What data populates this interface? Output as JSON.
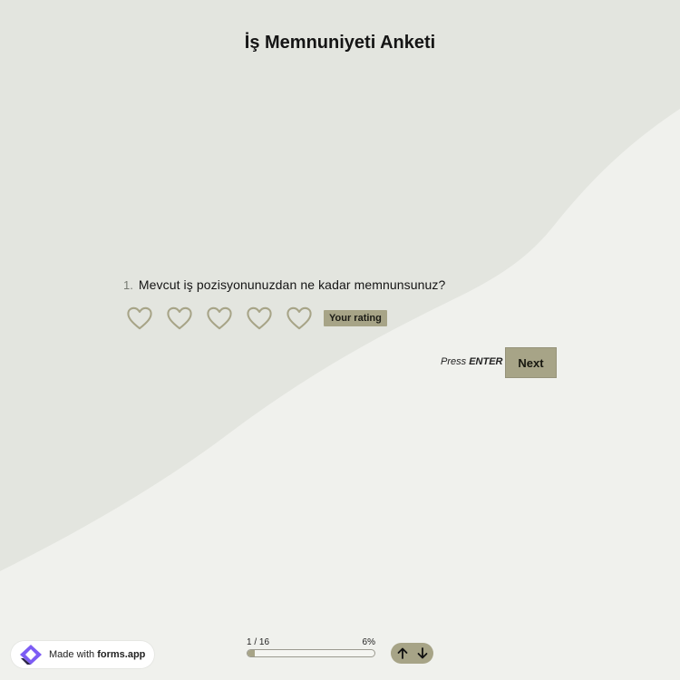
{
  "form": {
    "title": "İş Memnuniyeti Anketi"
  },
  "question": {
    "number": "1.",
    "text": "Mevcut iş pozisyonunuzdan ne kadar memnunsunuz?",
    "rating_max": 5,
    "rating_value": 0,
    "rating_tag": "Your rating",
    "icon": "heart-outline-icon"
  },
  "action": {
    "hint_prefix": "Press",
    "hint_key": "ENTER",
    "next_label": "Next"
  },
  "progress": {
    "current": "1 / 16",
    "percent_label": "6%",
    "percent_value": 6
  },
  "nav": {
    "up_icon": "arrow-up-icon",
    "down_icon": "arrow-down-icon"
  },
  "badge": {
    "prefix": "Made with",
    "brand": "forms.app"
  },
  "colors": {
    "accent": "#a7a487",
    "background": "#edefea",
    "heart_stroke": "#a7a487"
  }
}
